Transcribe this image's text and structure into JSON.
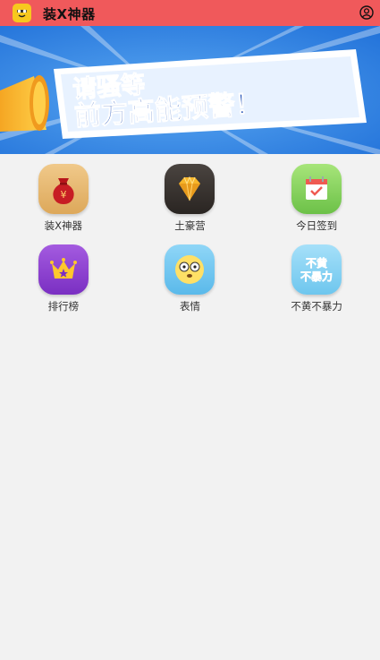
{
  "topbar": {
    "title": "装X神器",
    "color": "#f0595b"
  },
  "banner": {
    "line1": "请骚等",
    "line2": "前方高能预警！"
  },
  "grid": [
    {
      "label": "装X神器",
      "icon": "money-bag-icon",
      "color": "#e8b66a"
    },
    {
      "label": "土豪营",
      "icon": "diamond-icon",
      "color": "#3a3430"
    },
    {
      "label": "今日签到",
      "icon": "calendar-check-icon",
      "color": "#7fcf52"
    },
    {
      "label": "排行榜",
      "icon": "crown-icon",
      "color": "#8a3fcf"
    },
    {
      "label": "表情",
      "icon": "surprised-face-icon",
      "color": "#6fc6f0"
    },
    {
      "label": "不黄不暴力",
      "icon": "text-sticker-icon",
      "color": "#7fd0f4"
    }
  ],
  "sticker_text": {
    "line1": "不黄",
    "line2": "不暴力"
  }
}
